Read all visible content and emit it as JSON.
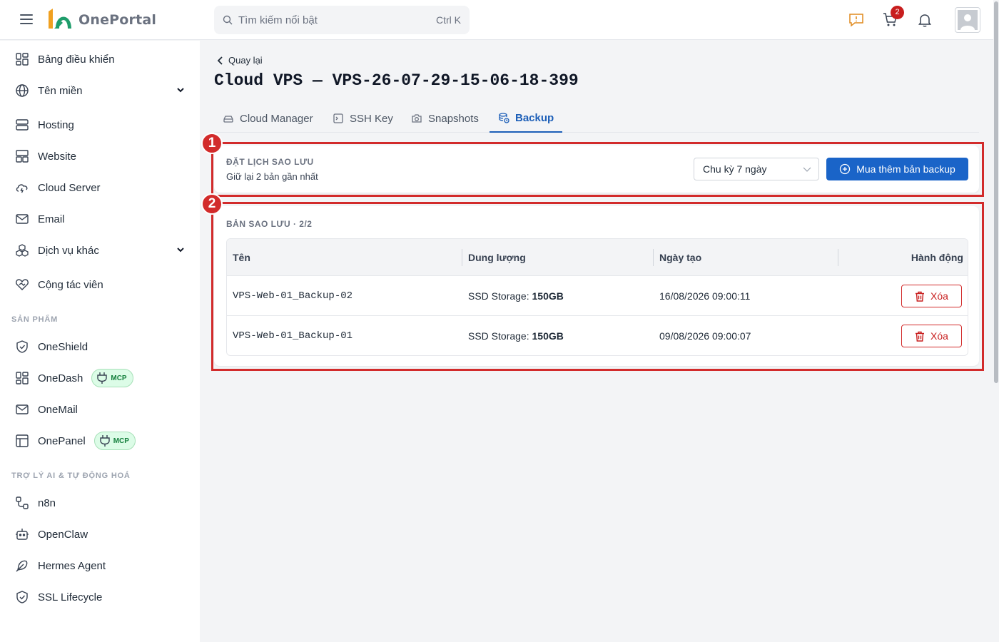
{
  "header": {
    "logo_text": "OnePortal",
    "search_placeholder": "Tìm kiếm nổi bật",
    "search_shortcut": "Ctrl K",
    "cart_count": "2"
  },
  "sidebar": {
    "items": [
      {
        "label": "Bảng điều khiển",
        "icon": "dashboard-icon"
      },
      {
        "label": "Tên miền",
        "icon": "globe-icon",
        "expandable": true
      },
      {
        "label": "Hosting",
        "icon": "server-icon"
      },
      {
        "label": "Website",
        "icon": "website-icon"
      },
      {
        "label": "Cloud Server",
        "icon": "cloud-icon"
      },
      {
        "label": "Email",
        "icon": "mail-icon"
      },
      {
        "label": "Dịch vụ khác",
        "icon": "boxes-icon",
        "expandable": true
      },
      {
        "label": "Cộng tác viên",
        "icon": "handshake-heart-icon"
      }
    ],
    "products_title": "SẢN PHẨM",
    "products": [
      {
        "label": "OneShield",
        "icon": "shield-check-icon"
      },
      {
        "label": "OneDash",
        "icon": "dashboard-icon",
        "badge": "MCP"
      },
      {
        "label": "OneMail",
        "icon": "mail-icon"
      },
      {
        "label": "OnePanel",
        "icon": "panel-icon",
        "badge": "MCP"
      }
    ],
    "ai_title": "TRỢ LÝ AI & TỰ ĐỘNG HOÁ",
    "ai_items": [
      {
        "label": "n8n",
        "icon": "workflow-icon"
      },
      {
        "label": "OpenClaw",
        "icon": "bot-icon"
      },
      {
        "label": "Hermes Agent",
        "icon": "feather-icon"
      },
      {
        "label": "SSL Lifecycle",
        "icon": "shield-check-icon"
      }
    ]
  },
  "main": {
    "back_label": "Quay lại",
    "title": "Cloud VPS — VPS-26-07-29-15-06-18-399",
    "tabs": [
      {
        "label": "Cloud Manager",
        "icon": "vps-icon"
      },
      {
        "label": "SSH Key",
        "icon": "terminal-icon"
      },
      {
        "label": "Snapshots",
        "icon": "camera-icon"
      },
      {
        "label": "Backup",
        "icon": "backup-icon",
        "active": true
      }
    ],
    "schedule": {
      "title": "ĐẶT LỊCH SAO LƯU",
      "subtitle": "Giữ lại 2 bản gần nhất",
      "cycle_selected": "Chu kỳ 7 ngày",
      "buy_button": "Mua thêm bản backup"
    },
    "backups": {
      "title": "BẢN SAO LƯU · 2/2",
      "columns": [
        "Tên",
        "Dung lượng",
        "Ngày tạo",
        "Hành động"
      ],
      "rows": [
        {
          "name": "VPS-Web-01_Backup-02",
          "storage_label": "SSD Storage:",
          "storage_value": "150GB",
          "created": "16/08/2026 09:00:11",
          "action": "Xóa"
        },
        {
          "name": "VPS-Web-01_Backup-01",
          "storage_label": "SSD Storage:",
          "storage_value": "150GB",
          "created": "09/08/2026 09:00:07",
          "action": "Xóa"
        }
      ]
    },
    "annotations": [
      "1",
      "2"
    ]
  },
  "colors": {
    "accent": "#1a64c8",
    "danger": "#c81e1e",
    "annotation": "#d22b2b",
    "mcp_bg": "#dcfce7"
  }
}
